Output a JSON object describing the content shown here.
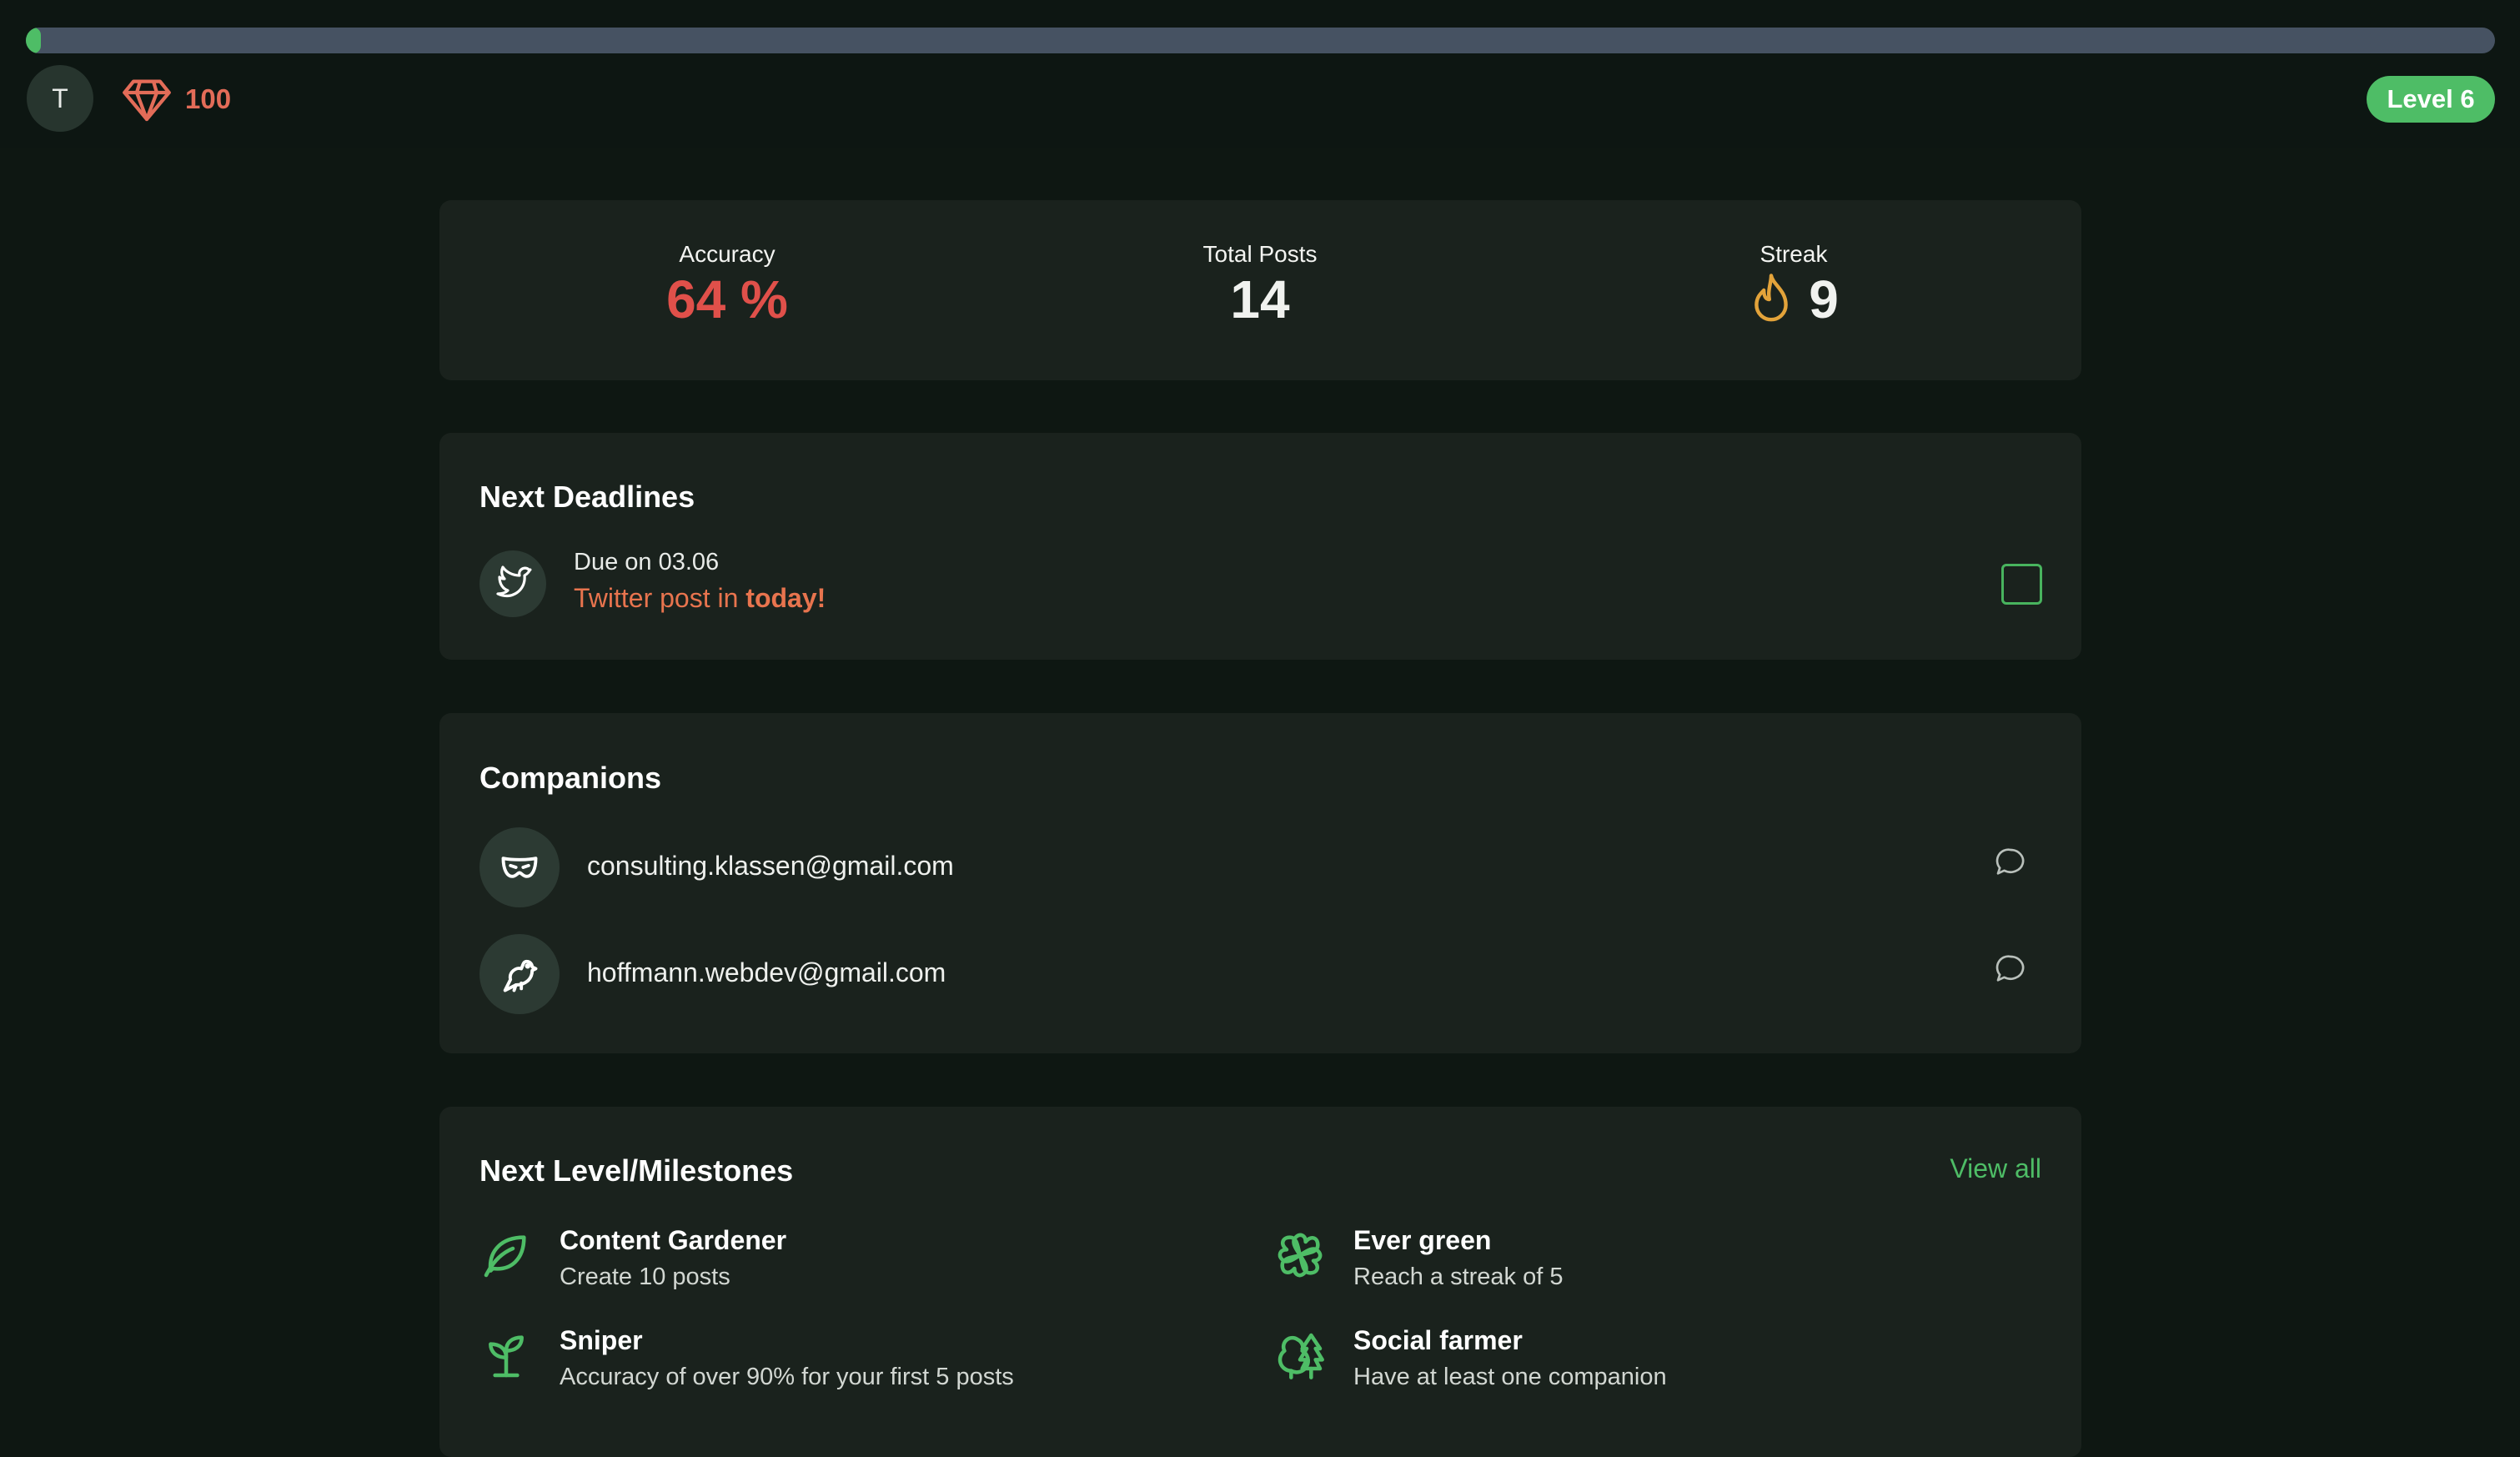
{
  "header": {
    "avatar_initial": "T",
    "gems": "100",
    "level": "Level 6",
    "level_progress": 0.006
  },
  "stats": {
    "accuracy_label": "Accuracy",
    "accuracy_value": "64 %",
    "posts_label": "Total Posts",
    "posts_value": "14",
    "streak_label": "Streak",
    "streak_value": "9"
  },
  "deadlines": {
    "title": "Next Deadlines",
    "items": [
      {
        "due": "Due on 03.06",
        "task_prefix": "Twitter post in ",
        "task_emphasis": "today!"
      }
    ]
  },
  "companions": {
    "title": "Companions",
    "items": [
      {
        "email": "consulting.klassen@gmail.com",
        "icon": "mask-icon"
      },
      {
        "email": "hoffmann.webdev@gmail.com",
        "icon": "bird-icon"
      }
    ]
  },
  "milestones": {
    "title": "Next Level/Milestones",
    "view_all": "View all",
    "items": [
      {
        "title": "Content Gardener",
        "desc": "Create 10 posts",
        "icon": "leaf-icon"
      },
      {
        "title": "Ever green",
        "desc": "Reach a streak of 5",
        "icon": "clover-icon"
      },
      {
        "title": "Sniper",
        "desc": "Accuracy of over 90% for your first 5 posts",
        "icon": "sprout-icon"
      },
      {
        "title": "Social farmer",
        "desc": "Have at least one companion",
        "icon": "trees-icon"
      }
    ]
  },
  "colors": {
    "accent": "#4ebd66",
    "danger": "#e0504a",
    "warning": "#e8744e",
    "streak": "#e3a33a"
  }
}
